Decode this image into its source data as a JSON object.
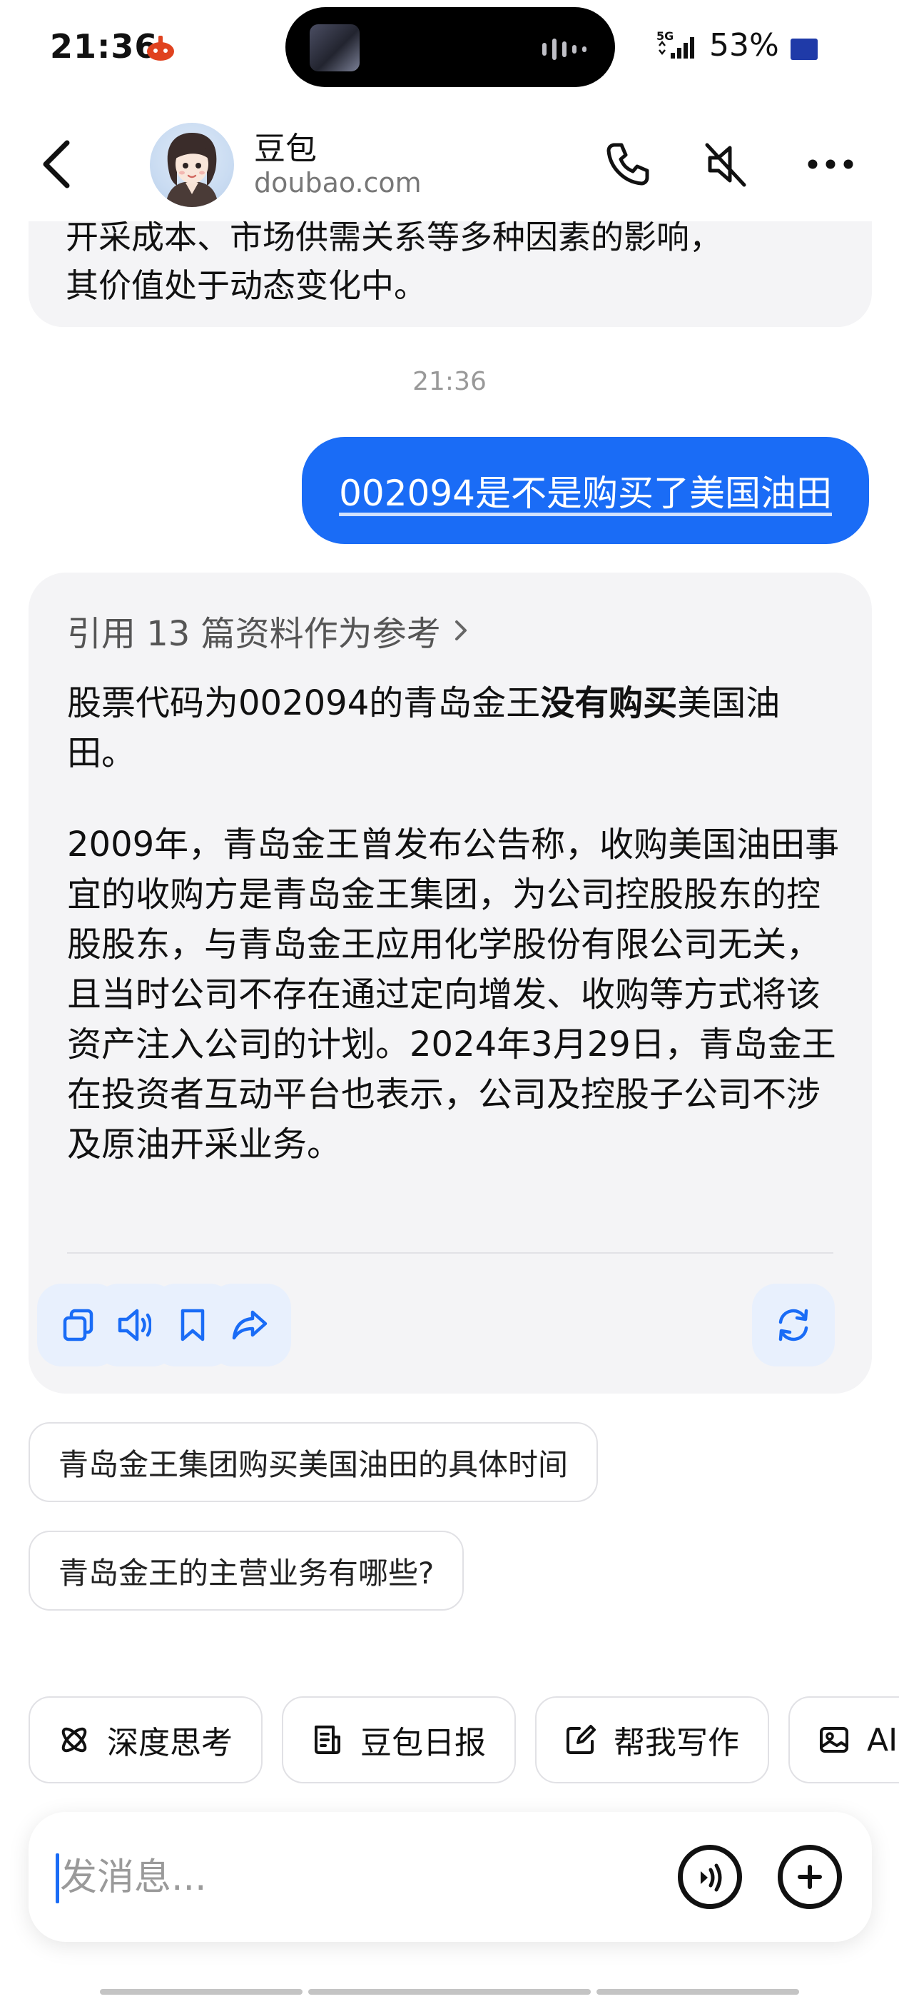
{
  "status_bar": {
    "time": "21:36",
    "network": "5G",
    "battery": "53%",
    "icons": [
      "app-notification-icon",
      "signal-icon",
      "battery-icon"
    ]
  },
  "header": {
    "title": "豆包",
    "subtitle": "doubao.com",
    "icons": [
      "back-icon",
      "phone-icon",
      "speaker-muted-icon",
      "more-icon"
    ]
  },
  "conversation": {
    "previous_answer_tail": "开采成本、市场供需关系等多种因素的影响，",
    "previous_answer_last_line": "其价值处于动态变化中。",
    "timestamp": "21:36",
    "user_message": "002094是不是购买了美国油田",
    "answer": {
      "references": "引用 13 篇资料作为参考",
      "para1_before": "股票代码为002094的青岛金王",
      "para1_bold": "没有购买",
      "para1_after": "美国油田。",
      "para2": "2009年，青岛金王曾发布公告称，收购美国油田事宜的收购方是青岛金王集团，为公司控股股东的控股股东，与青岛金王应用化学股份有限公司无关，且当时公司不存在通过定向增发、收购等方式将该资产注入公司的计划。2024年3月29日，青岛金王在投资者互动平台也表示，公司及控股子公司不涉及原油开采业务。",
      "actions": [
        "copy-icon",
        "read-aloud-icon",
        "bookmark-icon",
        "share-icon",
        "regenerate-icon"
      ]
    },
    "suggestions": [
      "青岛金王集团购买美国油田的具体时间",
      "青岛金王的主营业务有哪些?"
    ]
  },
  "tools": [
    {
      "label": "深度思考",
      "icon": "deep-think-icon"
    },
    {
      "label": "豆包日报",
      "icon": "daily-report-icon"
    },
    {
      "label": "帮我写作",
      "icon": "writing-icon"
    },
    {
      "label": "AI",
      "icon": "image-icon"
    }
  ],
  "input": {
    "placeholder": "发消息...",
    "value": ""
  },
  "colors": {
    "accent": "#1a6cf6",
    "bubble_bg": "#f4f4f6",
    "action_bg": "#e8f0fd"
  }
}
